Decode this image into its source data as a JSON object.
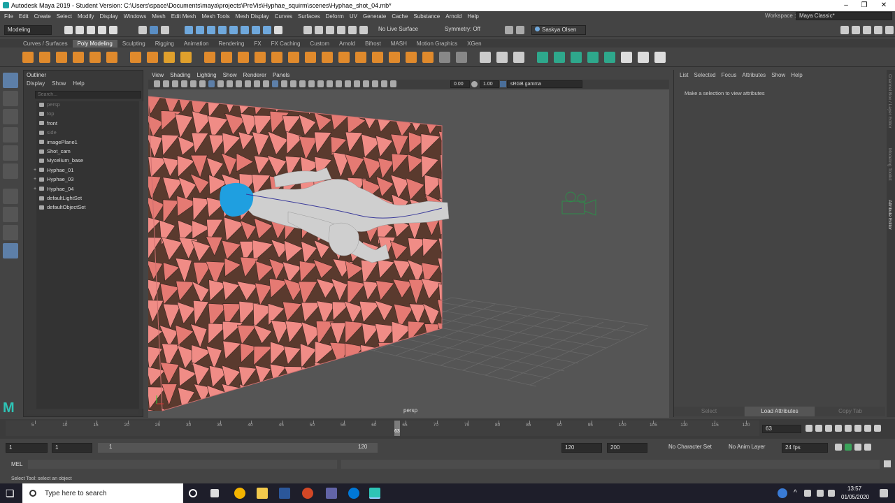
{
  "window": {
    "title": "Autodesk Maya 2019 - Student Version: C:\\Users\\space\\Documents\\maya\\projects\\PreVis\\Hyphae_squirm\\scenes\\Hyphae_shot_04.mb*",
    "workspace_label": "Workspace :",
    "workspace_value": "Maya Classic*"
  },
  "menu": [
    "File",
    "Edit",
    "Create",
    "Select",
    "Modify",
    "Display",
    "Windows",
    "Mesh",
    "Edit Mesh",
    "Mesh Tools",
    "Mesh Display",
    "Curves",
    "Surfaces",
    "Deform",
    "UV",
    "Generate",
    "Cache",
    "Substance",
    "Arnold",
    "Help"
  ],
  "status": {
    "mode": "Modeling",
    "live_surface": "No Live Surface",
    "symmetry": "Symmetry: Off",
    "user": "Saskya Olsen"
  },
  "shelf_tabs": [
    "Curves / Surfaces",
    "Poly Modeling",
    "Sculpting",
    "Rigging",
    "Animation",
    "Rendering",
    "FX",
    "FX Caching",
    "Custom",
    "Arnold",
    "Bifrost",
    "MASH",
    "Motion Graphics",
    "XGen"
  ],
  "shelf_active": "Poly Modeling",
  "outliner": {
    "title": "Outliner",
    "menu": [
      "Display",
      "Show",
      "Help"
    ],
    "search_placeholder": "Search...",
    "items": [
      {
        "label": "persp",
        "dim": true
      },
      {
        "label": "top",
        "dim": true
      },
      {
        "label": "front",
        "dim": false
      },
      {
        "label": "side",
        "dim": true
      },
      {
        "label": "imagePlane1",
        "dim": false
      },
      {
        "label": "Shot_cam",
        "dim": false
      },
      {
        "label": "Mycelium_base",
        "dim": false
      },
      {
        "label": "Hyphae_01",
        "dim": false
      },
      {
        "label": "Hyphae_03",
        "dim": false
      },
      {
        "label": "Hyphae_04",
        "dim": false
      },
      {
        "label": "defaultLightSet",
        "dim": false
      },
      {
        "label": "defaultObjectSet",
        "dim": false
      }
    ]
  },
  "viewport": {
    "menu": [
      "View",
      "Shading",
      "Lighting",
      "Show",
      "Renderer",
      "Panels"
    ],
    "val1": "0.00",
    "val2": "1.00",
    "colorspace": "sRGB gamma",
    "camera": "persp"
  },
  "attr_editor": {
    "menu": [
      "List",
      "Selected",
      "Focus",
      "Attributes",
      "Show",
      "Help"
    ],
    "message": "Make a selection to view attributes",
    "btn_select": "Select",
    "btn_load": "Load Attributes",
    "btn_copy": "Copy Tab"
  },
  "right_tabs": [
    "Channel Box / Layer Editor",
    "Modeling Toolkit",
    "Attribute Editor"
  ],
  "timeline": {
    "ticks": [
      "5",
      "10",
      "15",
      "20",
      "25",
      "30",
      "35",
      "40",
      "45",
      "50",
      "55",
      "60",
      "65",
      "70",
      "75",
      "80",
      "85",
      "90",
      "95",
      "100",
      "105",
      "110",
      "115",
      "120"
    ],
    "current": "63",
    "current_field": "63"
  },
  "range": {
    "start": "1",
    "start2": "1",
    "slider_start": "1",
    "slider_end": "120",
    "end": "120",
    "end2": "200",
    "character_set": "No Character Set",
    "anim_layer": "No Anim Layer",
    "fps": "24 fps"
  },
  "cmd": {
    "label": "MEL"
  },
  "help_line": "Select Tool: select an object",
  "taskbar": {
    "search": "Type here to search",
    "time": "13:57",
    "date": "01/05/2020"
  }
}
